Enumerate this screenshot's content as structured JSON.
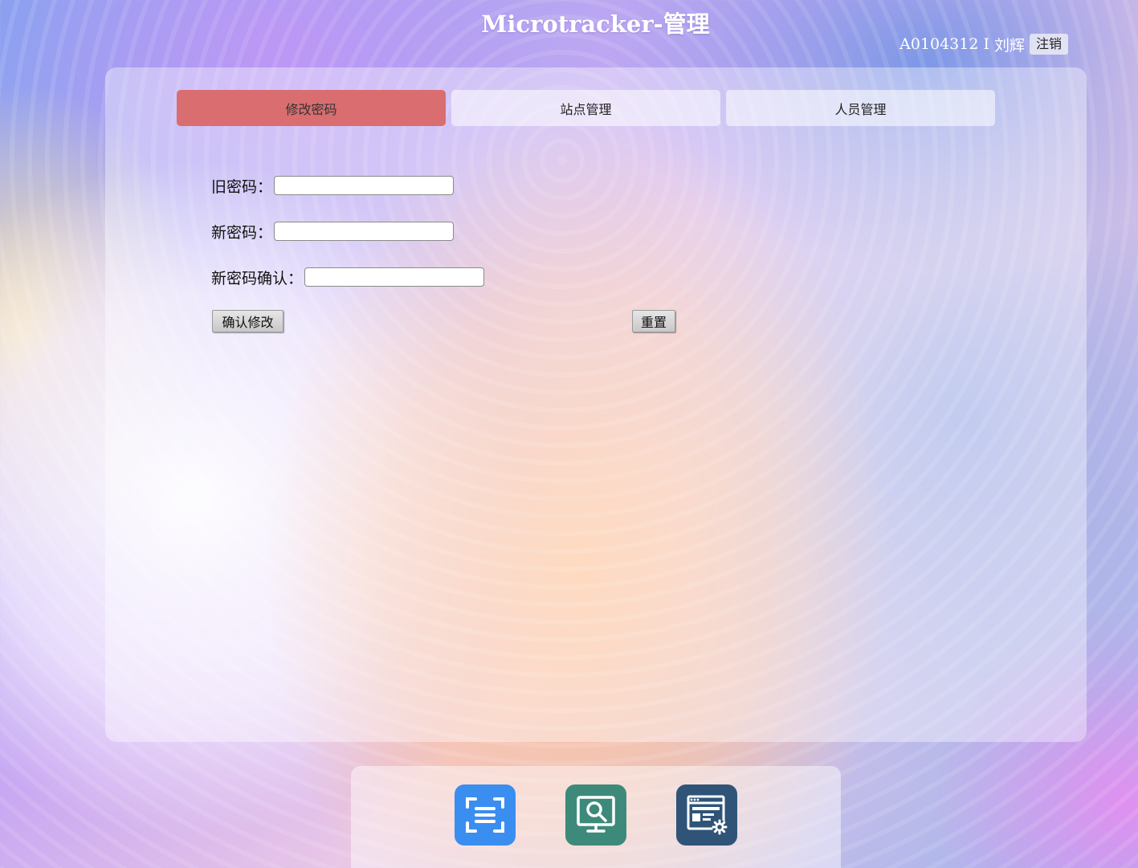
{
  "header": {
    "title": "Microtracker-管理",
    "user_id": "A0104312",
    "separator": "I",
    "user_name": "刘辉",
    "logout_label": "注销"
  },
  "tabs": [
    {
      "label": "修改密码",
      "active": true
    },
    {
      "label": "站点管理",
      "active": false
    },
    {
      "label": "人员管理",
      "active": false
    }
  ],
  "form": {
    "old_password_label": "旧密码：",
    "old_password_value": "",
    "new_password_label": "新密码：",
    "new_password_value": "",
    "confirm_password_label": "新密码确认：",
    "confirm_password_value": "",
    "confirm_button_label": "确认修改",
    "reset_button_label": "重置"
  },
  "dock": {
    "items": [
      {
        "icon": "scan-icon",
        "color": "#3a8ef0"
      },
      {
        "icon": "monitor-search-icon",
        "color": "#3e8a7a"
      },
      {
        "icon": "web-settings-icon",
        "color": "#2f5478"
      }
    ]
  },
  "colors": {
    "active_tab": "#d96d6f"
  }
}
